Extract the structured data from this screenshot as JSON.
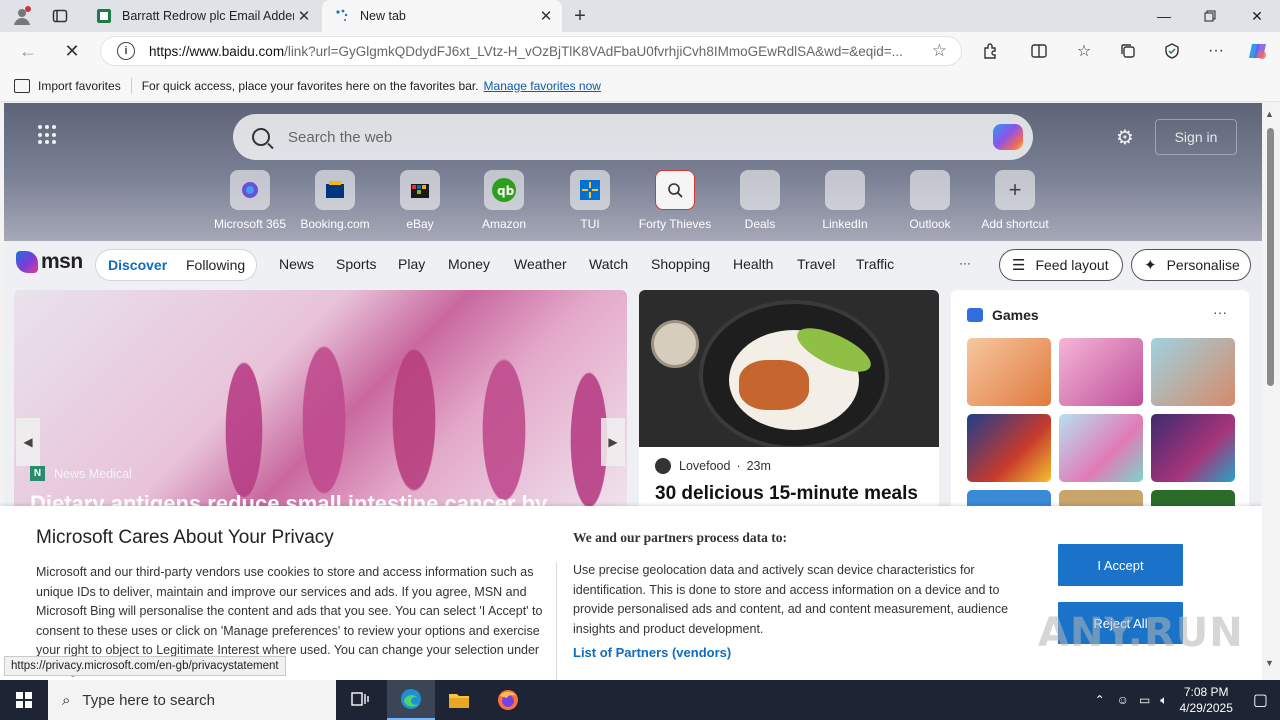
{
  "tabs": [
    {
      "title": "Barratt Redrow plc Email Addend"
    },
    {
      "title": "New tab"
    }
  ],
  "address": {
    "url_host": "https://www.baidu.com",
    "url_rest": "/link?url=GyGlgmkQDdydFJ6xt_LVtz-H_vOzBjTlK8VAdFbaU0fvrhjiCvh8IMmoGEwRdlSA&wd=&eqid=..."
  },
  "favbar": {
    "import_label": "Import favorites",
    "hint": "For quick access, place your favorites here on the favorites bar.",
    "manage_link": "Manage favorites now"
  },
  "search": {
    "placeholder": "Search the web"
  },
  "signin_label": "Sign in",
  "shortcuts": [
    {
      "label": "Microsoft 365"
    },
    {
      "label": "Booking.com"
    },
    {
      "label": "eBay"
    },
    {
      "label": "Amazon"
    },
    {
      "label": "TUI"
    },
    {
      "label": "Forty Thieves"
    },
    {
      "label": "Deals"
    },
    {
      "label": "LinkedIn"
    },
    {
      "label": "Outlook"
    },
    {
      "label": "Add shortcut"
    }
  ],
  "msn": {
    "logo": "msn",
    "pill": {
      "discover": "Discover",
      "following": "Following"
    },
    "nav": [
      "News",
      "Sports",
      "Play",
      "Money",
      "Weather",
      "Watch",
      "Shopping",
      "Health",
      "Travel",
      "Traffic"
    ],
    "more": "···",
    "feed_layout": "Feed layout",
    "personalise": "Personalise"
  },
  "cards": {
    "main": {
      "source": "News Medical",
      "headline": "Dietary antigens reduce small intestine cancer by"
    },
    "food": {
      "source": "Lovefood",
      "age": "23m",
      "headline": "30 delicious 15-minute meals"
    },
    "games": {
      "title": "Games",
      "more": "···"
    }
  },
  "privacy": {
    "title": "Microsoft Cares About Your Privacy",
    "body": "Microsoft and our third-party vendors use cookies to store and access information such as unique IDs to deliver, maintain and improve our services and ads. If you agree, MSN and Microsoft Bing will personalise the content and ads that you see. You can select 'I Accept' to consent to these uses or click on 'Manage preferences' to review your options and exercise your right to object to Legitimate Interest where used. You can change your selection under 'Manage Preferences' at the bottom of",
    "partners_title": "We and our partners process data to:",
    "partners_body": "Use precise geolocation data and actively scan device characteristics for identification. This is done to store and access information on a device and to provide personalised ads and content, ad and content measurement, audience insights and product development.",
    "partners_link": "List of Partners (vendors)",
    "accept": "I Accept",
    "reject": "Reject All"
  },
  "status_url": "https://privacy.microsoft.com/en-gb/privacystatement",
  "watermark": "ANY.RUN",
  "taskbar": {
    "search_placeholder": "Type here to search",
    "time": "7:08 PM",
    "date": "4/29/2025"
  }
}
